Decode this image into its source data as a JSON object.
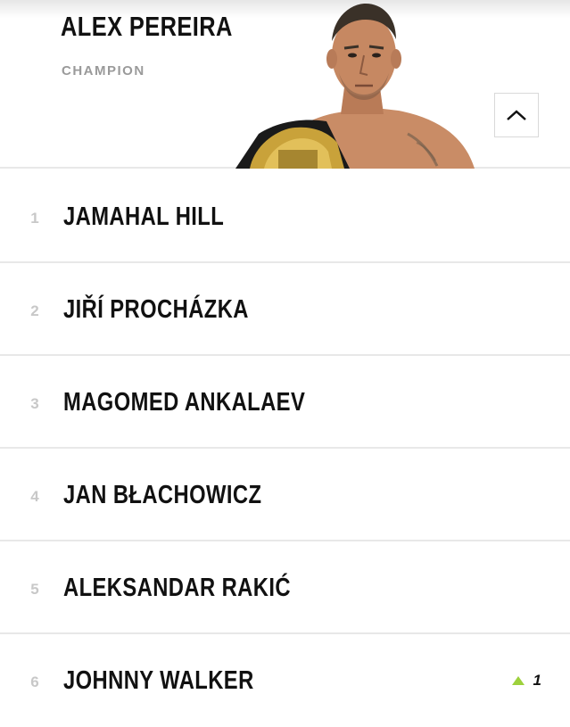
{
  "champion": {
    "name": "ALEX PEREIRA",
    "label": "CHAMPION",
    "photo_icon": "champion-photo",
    "collapse_icon": "chevron-up-icon"
  },
  "rankings": [
    {
      "rank": "1",
      "name": "JAMAHAL HILL",
      "movement": ""
    },
    {
      "rank": "2",
      "name": "JIŘÍ PROCHÁZKA",
      "movement": ""
    },
    {
      "rank": "3",
      "name": "MAGOMED ANKALAEV",
      "movement": ""
    },
    {
      "rank": "4",
      "name": "JAN BŁACHOWICZ",
      "movement": ""
    },
    {
      "rank": "5",
      "name": "ALEKSANDAR RAKIĆ",
      "movement": ""
    },
    {
      "rank": "6",
      "name": "JOHNNY WALKER",
      "movement": "1"
    }
  ],
  "colors": {
    "movement_up": "#9dd13c",
    "rank_number": "#c8c8c8",
    "label": "#9a9a9a"
  }
}
